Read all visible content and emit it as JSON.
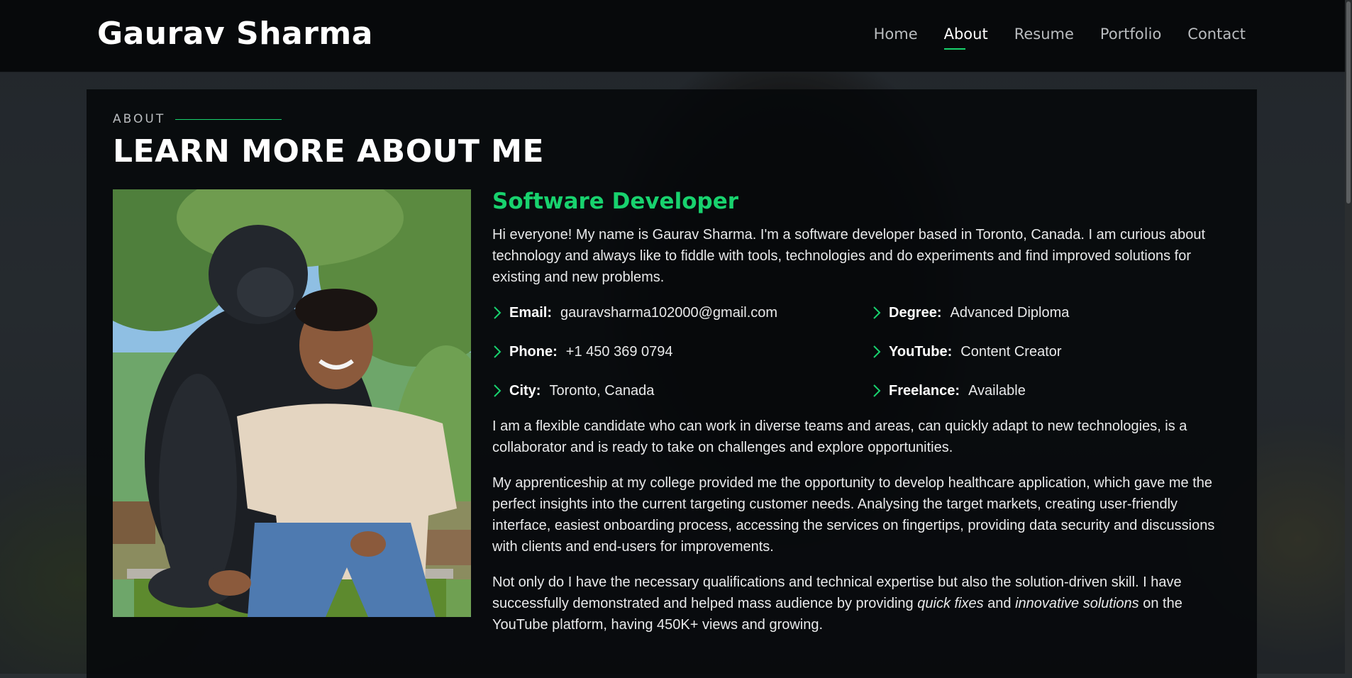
{
  "header": {
    "logo": "Gaurav Sharma",
    "nav": [
      {
        "label": "Home",
        "active": false
      },
      {
        "label": "About",
        "active": true
      },
      {
        "label": "Resume",
        "active": false
      },
      {
        "label": "Portfolio",
        "active": false
      },
      {
        "label": "Contact",
        "active": false
      }
    ]
  },
  "about": {
    "section_label": "ABOUT",
    "title": "LEARN MORE ABOUT ME",
    "role": "Software Developer",
    "intro": "Hi everyone! My name is Gaurav Sharma. I'm a software developer based in Toronto, Canada. I am curious about technology and always like to fiddle with tools, technologies and do experiments and find improved solutions for existing and new problems.",
    "facts": [
      {
        "key": "Email:",
        "value": "gauravsharma102000@gmail.com"
      },
      {
        "key": "Degree:",
        "value": "Advanced Diploma"
      },
      {
        "key": "Phone:",
        "value": "+1 450 369 0794"
      },
      {
        "key": "YouTube:",
        "value": "Content Creator"
      },
      {
        "key": "City:",
        "value": "Toronto, Canada"
      },
      {
        "key": "Freelance:",
        "value": "Available"
      }
    ],
    "para1": "I am a flexible candidate who can work in diverse teams and areas, can quickly adapt to new technologies, is a collaborator and is ready to take on challenges and explore opportunities.",
    "para2": "My apprenticeship at my college provided me the opportunity to develop healthcare application, which gave me the perfect insights into the current targeting customer needs. Analysing the target markets, creating user-friendly interface, easiest onboarding process, accessing the services on fingertips, providing data security and discussions with clients and end-users for improvements.",
    "para3_a": "Not only do I have the necessary qualifications and technical expertise but also the solution-driven skill. I have successfully demonstrated and helped mass audience by providing ",
    "para3_em1": "quick fixes",
    "para3_b": " and ",
    "para3_em2": "innovative solutions",
    "para3_c": " on the YouTube platform, having 450K+ views and growing."
  },
  "colors": {
    "accent": "#18d26e",
    "header_bg": "#07090b",
    "panel_bg": "#06080a"
  },
  "icons": {
    "fact_bullet": "chevron-right-icon",
    "photo": "profile-photo"
  }
}
